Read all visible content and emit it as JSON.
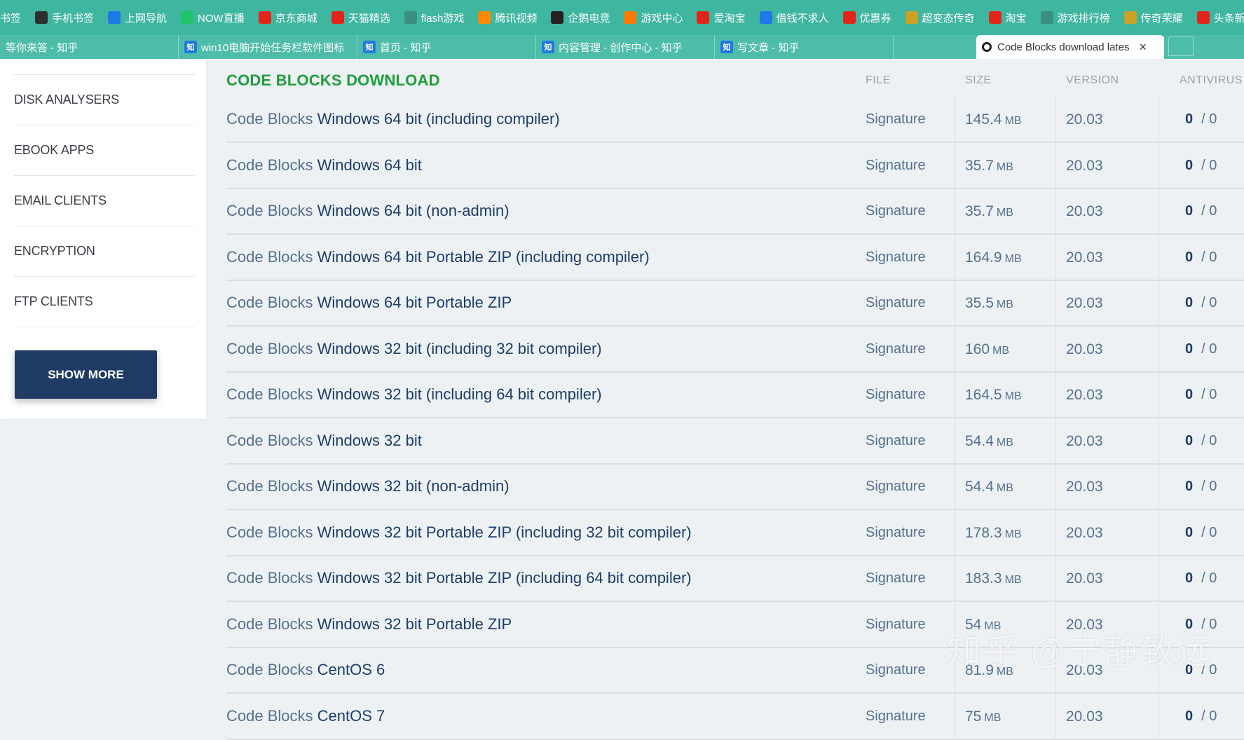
{
  "bookmarks": [
    {
      "label": "书签",
      "icon": "bookmark-icon",
      "color": ""
    },
    {
      "label": "手机书签",
      "icon": "phone-icon",
      "color": "#2f2f2f"
    },
    {
      "label": "上网导航",
      "icon": "ie-icon",
      "color": "#1e78e6"
    },
    {
      "label": "NOW直播",
      "icon": "play-icon",
      "color": "#21c46b"
    },
    {
      "label": "京东商城",
      "icon": "jd-icon",
      "color": "#e1251b"
    },
    {
      "label": "天猫精选",
      "icon": "tmall-icon",
      "color": "#e1251b"
    },
    {
      "label": "flash游戏",
      "icon": "flash-icon",
      "color": "#3b8f7f"
    },
    {
      "label": "腾讯视频",
      "icon": "video-icon",
      "color": "#ff8a00"
    },
    {
      "label": "企鹅电竞",
      "icon": "penguin-icon",
      "color": "#222222"
    },
    {
      "label": "游戏中心",
      "icon": "game-icon",
      "color": "#ff7a00"
    },
    {
      "label": "爱淘宝",
      "icon": "taobao-icon",
      "color": "#e1251b"
    },
    {
      "label": "借钱不求人",
      "icon": "loan-icon",
      "color": "#1e78e6"
    },
    {
      "label": "优惠券",
      "icon": "coupon-icon",
      "color": "#e1251b"
    },
    {
      "label": "超变态传奇",
      "icon": "legend-icon",
      "color": "#c9a227"
    },
    {
      "label": "淘宝",
      "icon": "tao-icon",
      "color": "#e1251b"
    },
    {
      "label": "游戏排行榜",
      "icon": "gamepad-icon",
      "color": "#3b8f7f"
    },
    {
      "label": "传奇荣耀",
      "icon": "honor-icon",
      "color": "#c9a227"
    },
    {
      "label": "头条新闻",
      "icon": "news-icon",
      "color": "#e1251b"
    }
  ],
  "tabs": [
    {
      "label": "等你来答 - 知乎",
      "has_icon": false
    },
    {
      "label": "win10电脑开始任务栏软件图标",
      "has_icon": true
    },
    {
      "label": "首页 - 知乎",
      "has_icon": true
    },
    {
      "label": "内容管理 - 创作中心 - 知乎",
      "has_icon": true
    },
    {
      "label": "写文章 - 知乎",
      "has_icon": true
    }
  ],
  "tab_icon_text": "知",
  "active_tab": {
    "label": "Code Blocks download lates",
    "close": "×"
  },
  "sidebar": {
    "items": [
      "DISK ANALYSERS",
      "EBOOK APPS",
      "EMAIL CLIENTS",
      "ENCRYPTION",
      "FTP CLIENTS"
    ],
    "show_more": "SHOW MORE"
  },
  "main": {
    "title": "CODE BLOCKS DOWNLOAD",
    "headers": {
      "file": "FILE",
      "size": "SIZE",
      "version": "VERSION",
      "antivirus": "ANTIVIRUS"
    },
    "rows": [
      {
        "brand": "Code Blocks",
        "platform": "Windows 64 bit (including compiler)",
        "file": "Signature",
        "size": "145.4",
        "unit": "MB",
        "version": "20.03",
        "av_pos": "0",
        "av_sep": "/",
        "av_total": "0"
      },
      {
        "brand": "Code Blocks",
        "platform": "Windows 64 bit",
        "file": "Signature",
        "size": "35.7",
        "unit": "MB",
        "version": "20.03",
        "av_pos": "0",
        "av_sep": "/",
        "av_total": "0"
      },
      {
        "brand": "Code Blocks",
        "platform": "Windows 64 bit (non-admin)",
        "file": "Signature",
        "size": "35.7",
        "unit": "MB",
        "version": "20.03",
        "av_pos": "0",
        "av_sep": "/",
        "av_total": "0"
      },
      {
        "brand": "Code Blocks",
        "platform": "Windows 64 bit Portable ZIP (including compiler)",
        "file": "Signature",
        "size": "164.9",
        "unit": "MB",
        "version": "20.03",
        "av_pos": "0",
        "av_sep": "/",
        "av_total": "0"
      },
      {
        "brand": "Code Blocks",
        "platform": "Windows 64 bit Portable ZIP",
        "file": "Signature",
        "size": "35.5",
        "unit": "MB",
        "version": "20.03",
        "av_pos": "0",
        "av_sep": "/",
        "av_total": "0"
      },
      {
        "brand": "Code Blocks",
        "platform": "Windows 32 bit (including 32 bit compiler)",
        "file": "Signature",
        "size": "160",
        "unit": "MB",
        "version": "20.03",
        "av_pos": "0",
        "av_sep": "/",
        "av_total": "0"
      },
      {
        "brand": "Code Blocks",
        "platform": "Windows 32 bit (including 64 bit compiler)",
        "file": "Signature",
        "size": "164.5",
        "unit": "MB",
        "version": "20.03",
        "av_pos": "0",
        "av_sep": "/",
        "av_total": "0"
      },
      {
        "brand": "Code Blocks",
        "platform": "Windows 32 bit",
        "file": "Signature",
        "size": "54.4",
        "unit": "MB",
        "version": "20.03",
        "av_pos": "0",
        "av_sep": "/",
        "av_total": "0"
      },
      {
        "brand": "Code Blocks",
        "platform": "Windows 32 bit (non-admin)",
        "file": "Signature",
        "size": "54.4",
        "unit": "MB",
        "version": "20.03",
        "av_pos": "0",
        "av_sep": "/",
        "av_total": "0"
      },
      {
        "brand": "Code Blocks",
        "platform": "Windows 32 bit Portable ZIP (including 32 bit compiler)",
        "file": "Signature",
        "size": "178.3",
        "unit": "MB",
        "version": "20.03",
        "av_pos": "0",
        "av_sep": "/",
        "av_total": "0"
      },
      {
        "brand": "Code Blocks",
        "platform": "Windows 32 bit Portable ZIP (including 64 bit compiler)",
        "file": "Signature",
        "size": "183.3",
        "unit": "MB",
        "version": "20.03",
        "av_pos": "0",
        "av_sep": "/",
        "av_total": "0"
      },
      {
        "brand": "Code Blocks",
        "platform": "Windows 32 bit Portable ZIP",
        "file": "Signature",
        "size": "54",
        "unit": "MB",
        "version": "20.03",
        "av_pos": "0",
        "av_sep": "/",
        "av_total": "0"
      },
      {
        "brand": "Code Blocks",
        "platform": "CentOS 6",
        "file": "Signature",
        "size": "81.9",
        "unit": "MB",
        "version": "20.03",
        "av_pos": "0",
        "av_sep": "/",
        "av_total": "0"
      },
      {
        "brand": "Code Blocks",
        "platform": "CentOS 7",
        "file": "Signature",
        "size": "75",
        "unit": "MB",
        "version": "20.03",
        "av_pos": "0",
        "av_sep": "/",
        "av_total": "0"
      }
    ]
  },
  "watermark": "知乎 @宁静致远"
}
